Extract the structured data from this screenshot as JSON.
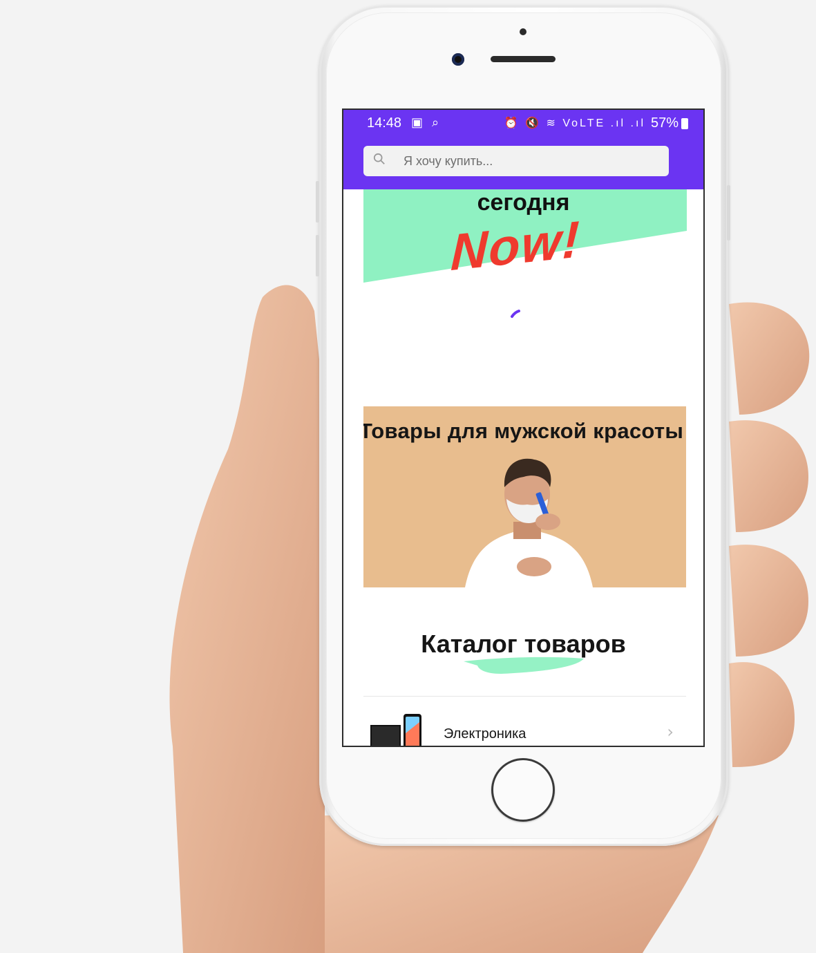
{
  "status_bar": {
    "time": "14:48",
    "left_icons": "▣ ⌕",
    "right_icons": "⏰ 🔇 ≋ VoLTE .ıl .ıl",
    "battery": "57%"
  },
  "search": {
    "placeholder": "Я хочу купить..."
  },
  "promo": {
    "word": "сегодня",
    "brand": "Now!"
  },
  "banner": {
    "title": "Товары для мужской красоты"
  },
  "catalog": {
    "title": "Каталог товаров",
    "items": [
      {
        "label": "Электроника",
        "chevron": "›"
      }
    ]
  },
  "colors": {
    "topbar": "#6b34f2",
    "promo_mint": "#8ff1c2",
    "now_red": "#ef3a2e",
    "banner_bg": "#e8bd8e"
  }
}
